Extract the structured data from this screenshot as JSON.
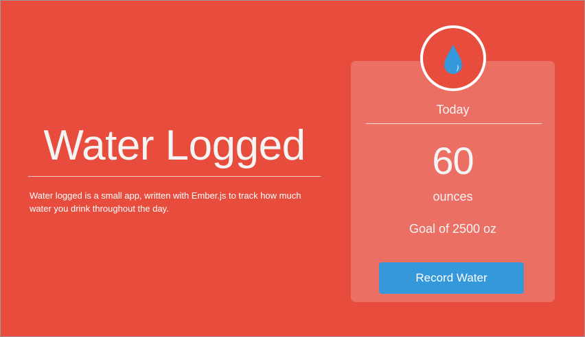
{
  "app": {
    "title": "Water Logged",
    "description": "Water logged is a small app, written with Ember.js to track how much water you drink throughout the day.",
    "background_color": "#e74c3c"
  },
  "tracker": {
    "icon": "water-drop-icon",
    "heading": "Today",
    "amount": "60",
    "unit": "ounces",
    "goal": "Goal of 2500 oz",
    "record_button": "Record Water",
    "button_color": "#3498db"
  }
}
